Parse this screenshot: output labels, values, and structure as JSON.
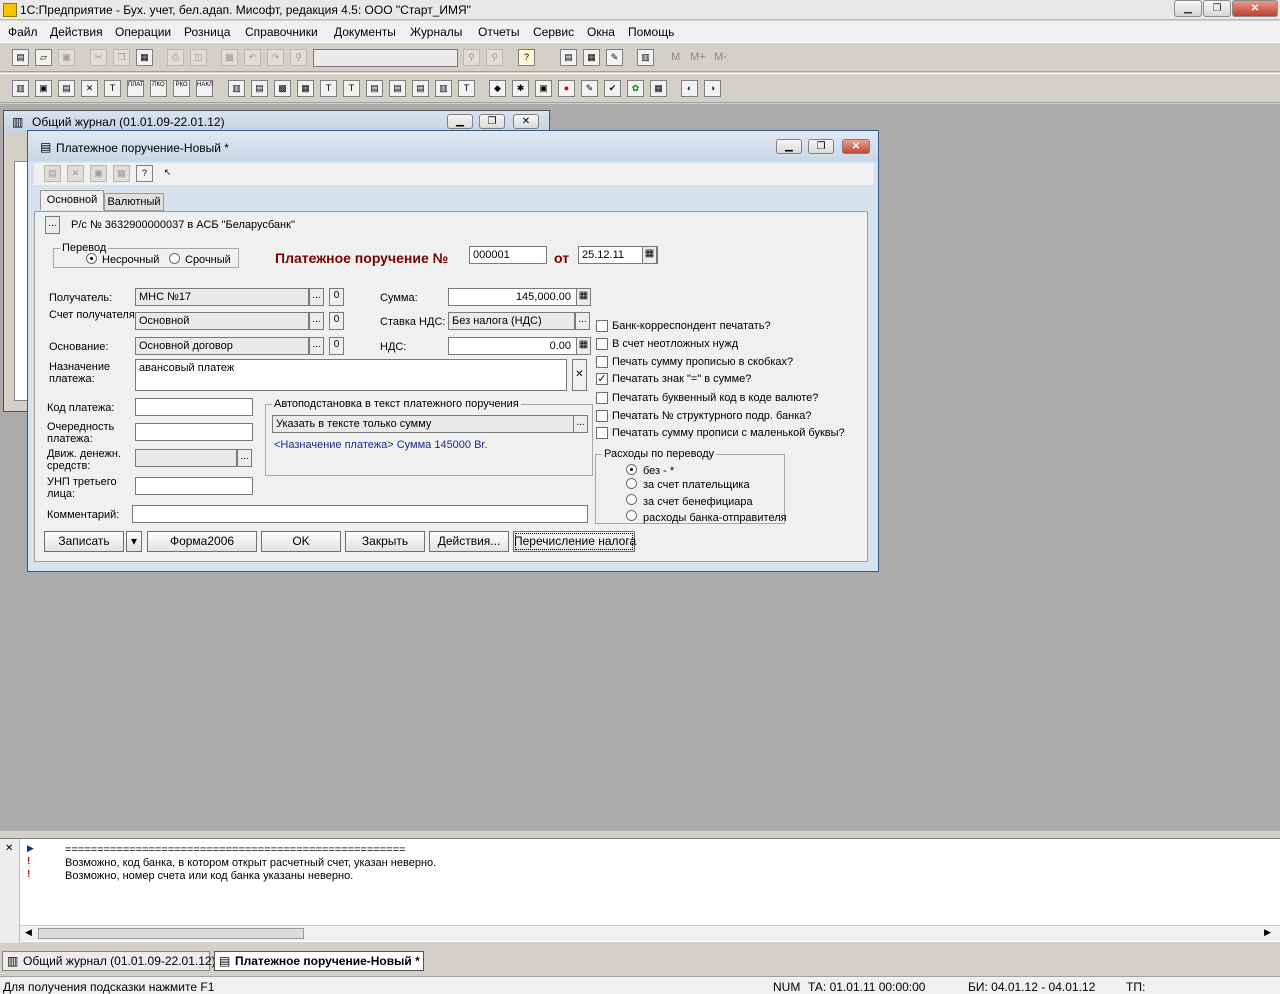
{
  "app": {
    "title": "1С:Предприятие - Бух. учет, бел.адап. Мисофт, редакция 4.5: ООО \"Старт_ИМЯ\""
  },
  "menu": [
    "Файл",
    "Действия",
    "Операции",
    "Розница",
    "Справочники",
    "Документы",
    "Журналы",
    "Отчеты",
    "Сервис",
    "Окна",
    "Помощь"
  ],
  "toolbar": {
    "m_labels": [
      "M",
      "M+",
      "M-"
    ],
    "icons1": [
      "new-icon",
      "open-icon",
      "save-icon",
      "cut-icon",
      "copy-icon",
      "paste-icon",
      "print-icon",
      "preview-icon",
      "calc-icon",
      "undo-icon",
      "redo-icon",
      "find-icon"
    ],
    "icons2": [
      "doc-icon",
      "journal-icon",
      "report-icon"
    ]
  },
  "toolbar2": {
    "labels": [
      "ПЛАТ",
      "ПКО",
      "РКО",
      "НАКЛ"
    ]
  },
  "journal": {
    "title": "Общий журнал (01.01.09-22.01.12)"
  },
  "doc": {
    "title": "Платежное поручение-Новый *",
    "tabs": [
      "Основной",
      "Валютный"
    ],
    "account_line": "Р/с № 3632900000037 в АСБ \"Беларусбанк\"",
    "transfer": {
      "label": "Перевод",
      "options": [
        "Несрочный",
        "Срочный"
      ]
    },
    "heading": "Платежное поручение №",
    "number": "000001",
    "from_label": "от",
    "date": "25.12.11",
    "recipient_label": "Получатель:",
    "recipient": "МНС №17",
    "recipient_account_label": "Счет получателя:",
    "recipient_account": "Основной",
    "basis_label": "Основание:",
    "basis": "Основной договор",
    "zero": "0",
    "purpose_label": "Назначение платежа:",
    "purpose": "авансовый платеж",
    "sum_label": "Сумма:",
    "sum": "145,000.00",
    "vat_rate_label": "Ставка НДС:",
    "vat_rate": "Без налога (НДС)",
    "vat_label": "НДС:",
    "vat": "0.00",
    "code_label": "Код платежа:",
    "priority_label": "Очередность платежа:",
    "cash_flow_label": "Движ. денежн. средств:",
    "unp_label": "УНП третьего лица:",
    "comment_label": "Комментарий:",
    "auto": {
      "label": "Автоподстановка в текст платежного поручения",
      "value": "Указать в тексте только сумму",
      "preview": "<Назначение платежа> Сумма 145000 Br."
    },
    "checks": [
      {
        "label": "Банк-корреспондент печатать?",
        "checked": false
      },
      {
        "label": "В счет неотложных нужд",
        "checked": false
      },
      {
        "label": "Печать сумму прописью в скобках?",
        "checked": false
      },
      {
        "label": "Печатать знак \"=\" в сумме?",
        "checked": true
      },
      {
        "label": "Печатать буквенный код в коде валюте?",
        "checked": false
      },
      {
        "label": "Печатать № структурного подр. банка?",
        "checked": false
      },
      {
        "label": "Печатать сумму прописи с маленькой буквы?",
        "checked": false
      }
    ],
    "expenses": {
      "label": "Расходы по переводу",
      "options": [
        "без - *",
        "за счет плательщика",
        "за счет бенефициара",
        "расходы банка-отправителя"
      ],
      "selected": 0
    },
    "buttons": {
      "save": "Записать",
      "form": "Форма2006",
      "ok": "OK",
      "close": "Закрыть",
      "actions": "Действия...",
      "tax": "Перечисление налога"
    }
  },
  "messages": {
    "lines": [
      "=====================================================",
      "Возможно, код банка, в котором открыт расчетный счет, указан неверно.",
      "Возможно, номер счета или код банка указаны неверно."
    ]
  },
  "taskbar": {
    "items": [
      "Общий журнал (01.01.09-22.01.12)",
      "Платежное поручение-Новый *"
    ]
  },
  "status": {
    "hint": "Для получения подсказки нажмите F1",
    "num": "NUM",
    "ta": "ТА: 01.01.11  00:00:00",
    "bi": "БИ: 04.01.12 - 04.01.12",
    "tp": "ТП:"
  }
}
